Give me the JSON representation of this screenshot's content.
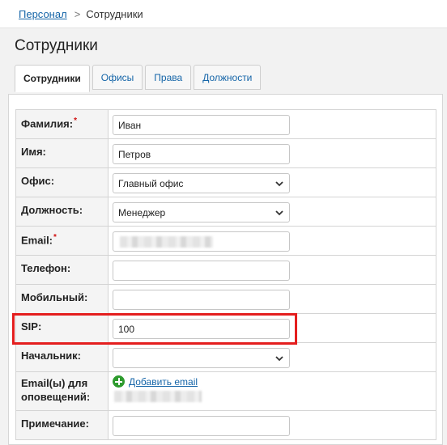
{
  "breadcrumb": {
    "parent": "Персонал",
    "separator": ">",
    "current": "Сотрудники"
  },
  "page": {
    "title": "Сотрудники"
  },
  "tabs": [
    {
      "label": "Сотрудники",
      "active": true
    },
    {
      "label": "Офисы",
      "active": false
    },
    {
      "label": "Права",
      "active": false
    },
    {
      "label": "Должности",
      "active": false
    }
  ],
  "form": {
    "last_name": {
      "label": "Фамилия:",
      "required_mark": "*",
      "value": "Иван"
    },
    "first_name": {
      "label": "Имя:",
      "value": "Петров"
    },
    "office": {
      "label": "Офис:",
      "value": "Главный офис"
    },
    "position": {
      "label": "Должность:",
      "value": "Менеджер"
    },
    "email": {
      "label": "Email:",
      "required_mark": "*",
      "value": ""
    },
    "phone": {
      "label": "Телефон:",
      "value": ""
    },
    "mobile": {
      "label": "Мобильный:",
      "value": ""
    },
    "sip": {
      "label": "SIP:",
      "value": "100"
    },
    "manager": {
      "label": "Начальник:",
      "value": ""
    },
    "notify_emails": {
      "label": "Email(ы) для оповещений:",
      "add_link": "Добавить email"
    },
    "note": {
      "label": "Примечание:",
      "value": ""
    }
  },
  "colors": {
    "link": "#1565a8",
    "required": "#d01010",
    "highlight": "#e41e1e",
    "add_icon": "#2e9b2e"
  },
  "icons": {
    "select_arrow": "chevron-down-icon",
    "add": "plus-circle-icon"
  }
}
